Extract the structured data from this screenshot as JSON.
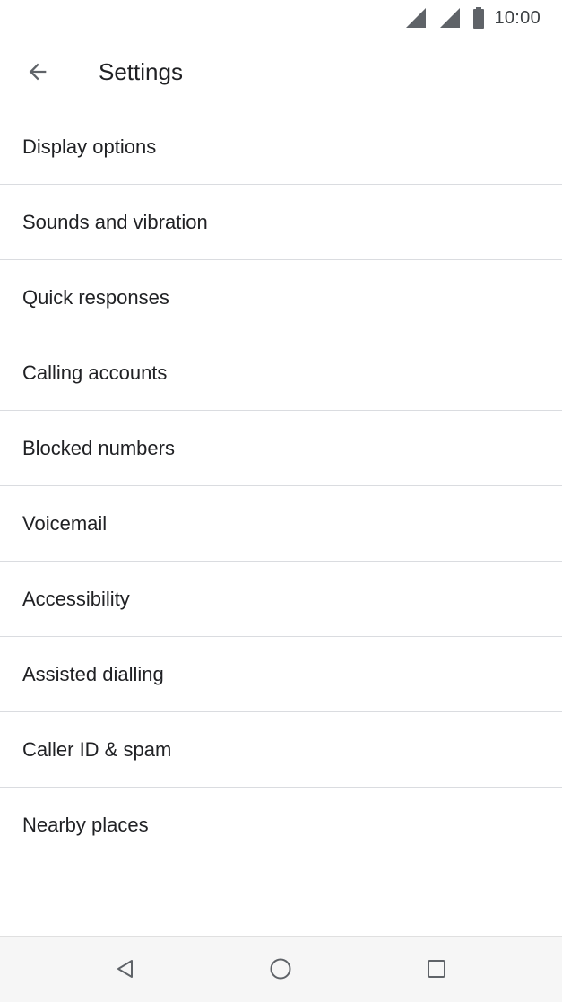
{
  "status_bar": {
    "time": "10:00",
    "icons": [
      "wifi-signal-icon",
      "cell-signal-icon",
      "battery-icon"
    ]
  },
  "app_bar": {
    "back_icon": "arrow-back-icon",
    "title": "Settings"
  },
  "settings": {
    "items": [
      {
        "label": "Display options"
      },
      {
        "label": "Sounds and vibration"
      },
      {
        "label": "Quick responses"
      },
      {
        "label": "Calling accounts"
      },
      {
        "label": "Blocked numbers"
      },
      {
        "label": "Voicemail"
      },
      {
        "label": "Accessibility"
      },
      {
        "label": "Assisted dialling"
      },
      {
        "label": "Caller ID & spam"
      },
      {
        "label": "Nearby places"
      }
    ]
  },
  "nav_bar": {
    "icons": [
      "nav-back-icon",
      "nav-home-icon",
      "nav-recents-icon"
    ]
  },
  "colors": {
    "text_primary": "#202124",
    "divider": "#dadce0",
    "icon": "#5f6368",
    "nav_background": "#f6f6f6"
  }
}
